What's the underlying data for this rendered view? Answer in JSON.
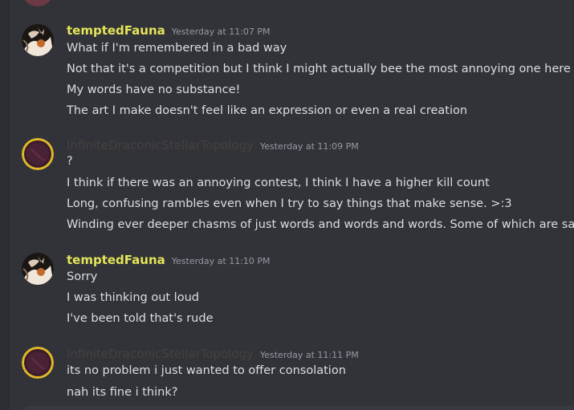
{
  "messages": [
    {
      "username": "temptedFauna",
      "timestamp": "Yesterday at 11:07 PM",
      "lines": [
        "What if I'm remembered in a bad way",
        "Not that it's a competition but I think I might actually bee the most annoying one here",
        "My words have no substance!",
        "The art I make doesn't feel like an expression or even a real creation"
      ]
    },
    {
      "username": "InfiniteDraconicStellarTopology",
      "timestamp": "Yesterday at 11:09 PM",
      "lines": [
        "?",
        "I think if there was an annoying contest, I think I have a higher kill count",
        "Long, confusing rambles even when I try to say things that make sense. >:3",
        "Winding ever deeper chasms of just words and words and words. Some of which are sane."
      ]
    },
    {
      "username": "temptedFauna",
      "timestamp": "Yesterday at 11:10 PM",
      "lines": [
        "Sorry",
        "I was thinking out loud",
        "I've been told that's rude"
      ]
    },
    {
      "username": "InfiniteDraconicStellarTopology",
      "timestamp": "Yesterday at 11:11 PM",
      "lines": [
        "its no problem i just wanted to offer consolation",
        "nah its fine i think?"
      ]
    }
  ],
  "colors": {
    "background": "#313338",
    "fauna_name": "#e4e45a",
    "idst_name": "#44403f",
    "text": "#dbdee1",
    "timestamp": "#949ba4"
  }
}
